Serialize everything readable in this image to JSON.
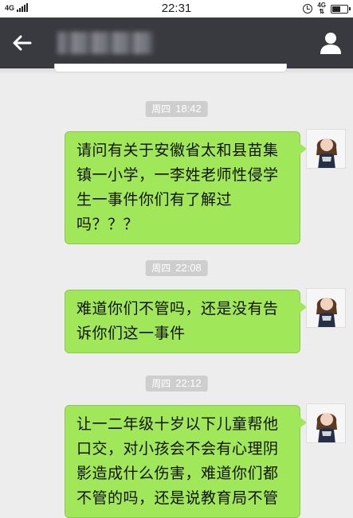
{
  "status_bar": {
    "network_left": "4G",
    "time": "22:31",
    "network_right": "4G",
    "battery_level": 0.55
  },
  "header": {
    "back_icon": "back-arrow-icon",
    "contact_name": "",
    "profile_icon": "person-icon"
  },
  "messages": [
    {
      "time_day": "周四",
      "time": "18:42",
      "text": "请问有关于安徽省太和县苗集\n镇一小学，一李姓老师性侵学\n生一事件你们有了解过\n吗？？？"
    },
    {
      "time_day": "周四",
      "time": "22:08",
      "text": "难道你们不管吗，还是没有告\n诉你们这一事件"
    },
    {
      "time_day": "周四",
      "time": "22:12",
      "text": "让一二年级十岁以下儿童帮他\n口交，对小孩会不会有心理阴\n影造成什么伤害，难道你们都\n不管的吗，还是说教育局不管"
    }
  ],
  "colors": {
    "bubble_green": "#a0e75a",
    "title_bar": "#393a3f",
    "chat_background": "#ededed",
    "time_badge": "#cecece"
  }
}
